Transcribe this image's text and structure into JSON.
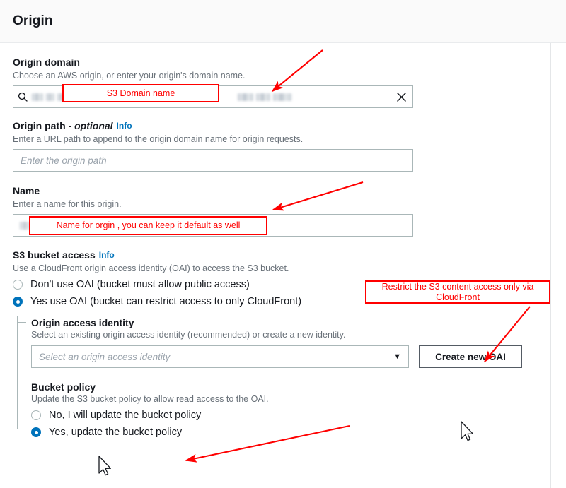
{
  "header": {
    "title": "Origin"
  },
  "fields": {
    "origin_domain": {
      "label": "Origin domain",
      "description": "Choose an AWS origin, or enter your origin's domain name.",
      "value_redacted": true,
      "search_icon": "search-icon",
      "clear_icon": "close-icon"
    },
    "origin_path": {
      "label": "Origin path - ",
      "label_optional": "optional",
      "info": "Info",
      "description": "Enter a URL path to append to the origin domain name for origin requests.",
      "placeholder": "Enter the origin path",
      "value": ""
    },
    "name": {
      "label": "Name",
      "description": "Enter a name for this origin.",
      "value_redacted": true
    },
    "s3_bucket_access": {
      "label": "S3 bucket access",
      "info": "Info",
      "description": "Use a CloudFront origin access identity (OAI) to access the S3 bucket.",
      "options": [
        {
          "label": "Don't use OAI (bucket must allow public access)",
          "selected": false
        },
        {
          "label": "Yes use OAI (bucket can restrict access to only CloudFront)",
          "selected": true
        }
      ]
    },
    "origin_access_identity": {
      "label": "Origin access identity",
      "description": "Select an existing origin access identity (recommended) or create a new identity.",
      "placeholder": "Select an origin access identity",
      "value": "",
      "caret_icon": "chevron-down-icon",
      "create_button": "Create new OAI"
    },
    "bucket_policy": {
      "label": "Bucket policy",
      "description": "Update the S3 bucket policy to allow read access to the OAI.",
      "options": [
        {
          "label": "No, I will update the bucket policy",
          "selected": false
        },
        {
          "label": "Yes, update the bucket policy",
          "selected": true
        }
      ]
    }
  },
  "annotations": [
    {
      "id": "anno-s3-domain",
      "text": "S3 Domain name"
    },
    {
      "id": "anno-name",
      "text": "Name for orgin , you can keep it default as well"
    },
    {
      "id": "anno-restrict",
      "text": "Restrict the S3 content access only via CloudFront"
    }
  ],
  "colors": {
    "annotation": "#ff0000",
    "accent": "#0073bb",
    "link": "#0073bb",
    "text": "#16191f",
    "muted": "#687078",
    "border": "#aab7b8",
    "header_bg": "#fafafa"
  }
}
